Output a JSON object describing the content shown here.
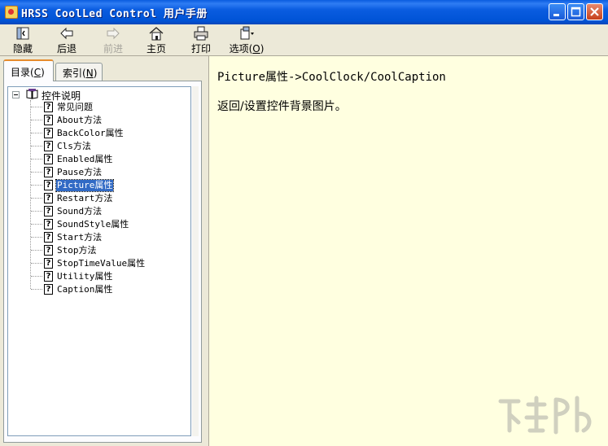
{
  "window": {
    "title": "HRSS CoolLed Control 用户手册",
    "controls": [
      "minimize-icon",
      "maximize-icon",
      "close-icon"
    ]
  },
  "toolbar": {
    "hide_label": "隐藏",
    "back_label": "后退",
    "forward_label": "前进",
    "home_label": "主页",
    "print_label": "打印",
    "options_label": "选项",
    "options_key": "O"
  },
  "tabs": {
    "contents_label": "目录",
    "contents_key": "C",
    "index_label": "索引",
    "index_key": "N"
  },
  "tree": {
    "root": "控件说明",
    "items": [
      {
        "label": "常见问题",
        "selected": false
      },
      {
        "label": "About方法",
        "selected": false
      },
      {
        "label": "BackColor属性",
        "selected": false
      },
      {
        "label": "Cls方法",
        "selected": false
      },
      {
        "label": "Enabled属性",
        "selected": false
      },
      {
        "label": "Pause方法",
        "selected": false
      },
      {
        "label": "Picture属性",
        "selected": true
      },
      {
        "label": "Restart方法",
        "selected": false
      },
      {
        "label": "Sound方法",
        "selected": false
      },
      {
        "label": "SoundStyle属性",
        "selected": false
      },
      {
        "label": "Start方法",
        "selected": false
      },
      {
        "label": "Stop方法",
        "selected": false
      },
      {
        "label": "StopTimeValue属性",
        "selected": false
      },
      {
        "label": "Utility属性",
        "selected": false
      },
      {
        "label": "Caption属性",
        "selected": false
      }
    ]
  },
  "content": {
    "title": "Picture属性->CoolClock/CoolCaption",
    "body": "返回/设置控件背景图片。"
  },
  "colors": {
    "title_bar": "#0a5ce0",
    "content_bg": "#ffffe0",
    "selection": "#316ac5"
  }
}
